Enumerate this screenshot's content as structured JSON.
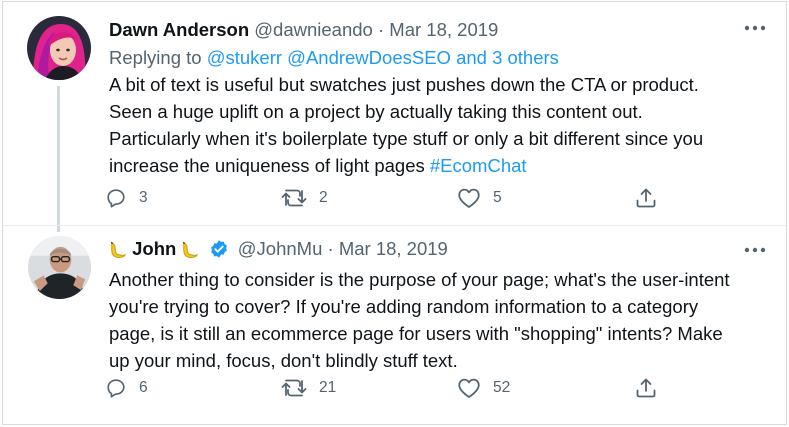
{
  "tweets": [
    {
      "author_name": "Dawn Anderson",
      "handle": "@dawnieando",
      "separator": "·",
      "date": "Mar 18, 2019",
      "reply_prefix": "Replying to",
      "reply_mentions": "@stukerr @AndrewDoesSEO and 3 others",
      "text_lines": [
        "A bit of text is useful but swatches just pushes down the CTA or product.",
        "Seen a huge uplift on a project by actually taking this content out.",
        "Particularly when it's boilerplate type stuff or only a bit different since you"
      ],
      "text_last_line": "increase the uniqueness of light pages ",
      "hashtag": "#EcomChat",
      "replies": "3",
      "retweets": "2",
      "likes": "5",
      "avatar_icon": "avatar-pink-hair-woman"
    },
    {
      "author_name": "John",
      "name_emoji": "banana-icon",
      "verified_icon": "verified-badge-icon",
      "handle": "@JohnMu",
      "separator": "·",
      "date": "Mar 18, 2019",
      "text_lines": [
        "Another thing to consider is the purpose of your page; what's the user-intent",
        "you're trying to cover? If you're adding random information to a category",
        "page, is it still an ecommerce page for users with \"shopping\" intents? Make",
        "up your mind, focus, don't blindly stuff text."
      ],
      "replies": "6",
      "retweets": "21",
      "likes": "52",
      "avatar_icon": "avatar-man-glasses"
    }
  ],
  "colors": {
    "text": "#0f1419",
    "muted": "#536471",
    "link": "#1d9bf0",
    "verified": "#1d9bf0",
    "thread_line": "#cfd9de"
  }
}
